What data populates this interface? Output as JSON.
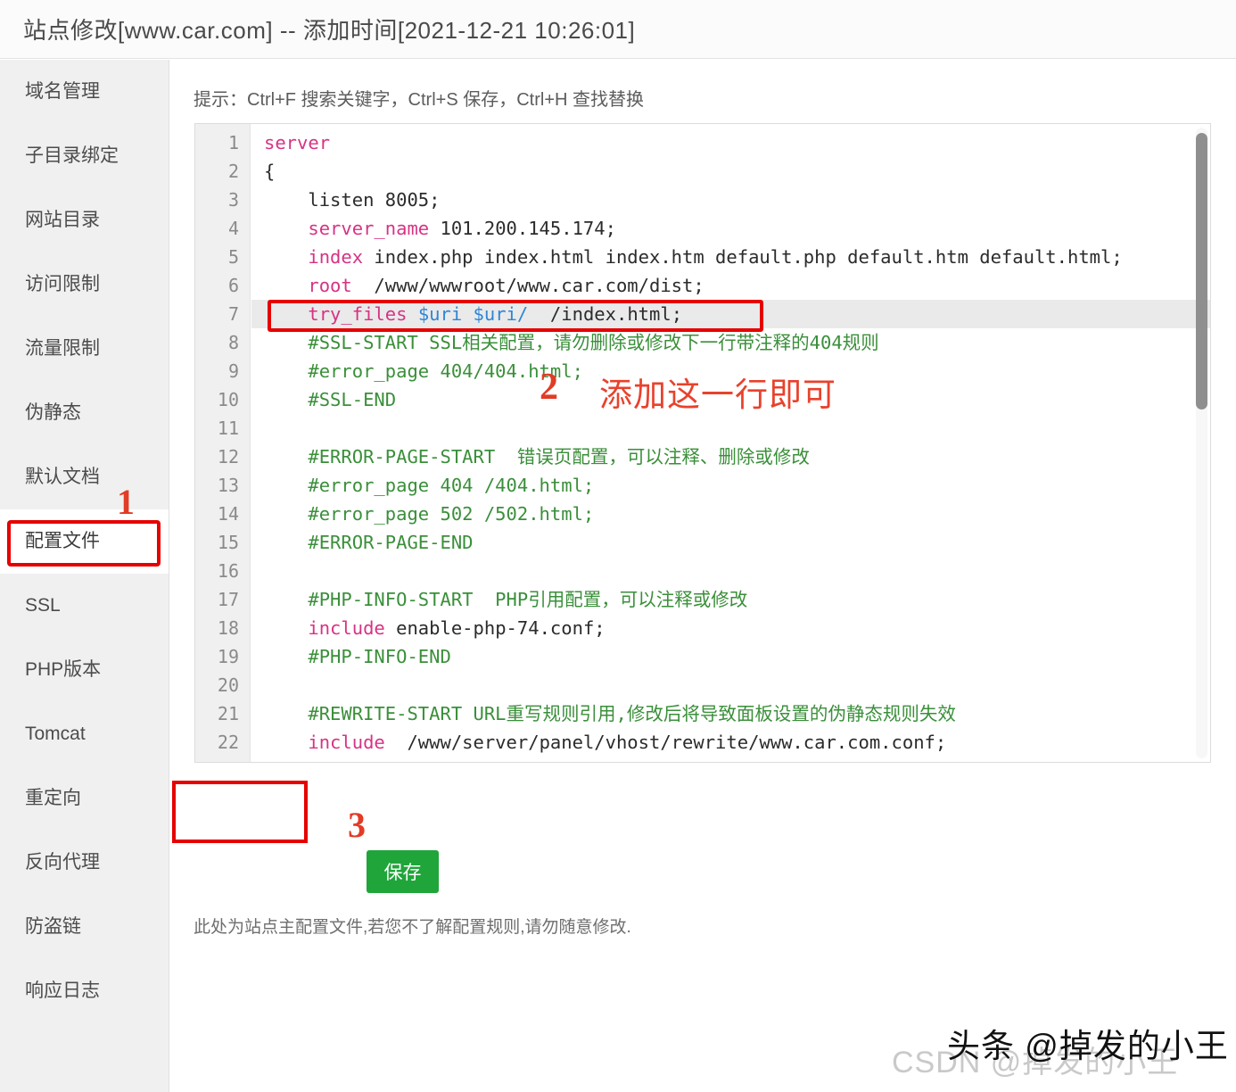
{
  "titlebar": {
    "title": "站点修改[www.car.com] -- 添加时间[2021-12-21 10:26:01]"
  },
  "sidebar": {
    "items": [
      {
        "label": "域名管理",
        "active": false
      },
      {
        "label": "子目录绑定",
        "active": false
      },
      {
        "label": "网站目录",
        "active": false
      },
      {
        "label": "访问限制",
        "active": false
      },
      {
        "label": "流量限制",
        "active": false
      },
      {
        "label": "伪静态",
        "active": false
      },
      {
        "label": "默认文档",
        "active": false
      },
      {
        "label": "配置文件",
        "active": true
      },
      {
        "label": "SSL",
        "active": false
      },
      {
        "label": "PHP版本",
        "active": false
      },
      {
        "label": "Tomcat",
        "active": false
      },
      {
        "label": "重定向",
        "active": false
      },
      {
        "label": "反向代理",
        "active": false
      },
      {
        "label": "防盗链",
        "active": false
      },
      {
        "label": "响应日志",
        "active": false
      }
    ]
  },
  "main": {
    "hint": "提示：Ctrl+F 搜索关键字，Ctrl+S 保存，Ctrl+H 查找替换",
    "save_label": "保存",
    "footnote": "此处为站点主配置文件,若您不了解配置规则,请勿随意修改."
  },
  "editor": {
    "scroll_thumb_position": "top",
    "highlighted_line": 7,
    "lines": [
      {
        "n": "1",
        "tokens": [
          {
            "t": "server",
            "c": "kw"
          }
        ]
      },
      {
        "n": "2",
        "tokens": [
          {
            "t": "{",
            "c": "plain"
          }
        ]
      },
      {
        "n": "3",
        "tokens": [
          {
            "t": "    listen 8005;",
            "c": "plain"
          }
        ]
      },
      {
        "n": "4",
        "tokens": [
          {
            "t": "    ",
            "c": "plain"
          },
          {
            "t": "server_name",
            "c": "kw"
          },
          {
            "t": " 101.200.145.174;",
            "c": "plain"
          }
        ]
      },
      {
        "n": "5",
        "tokens": [
          {
            "t": "    ",
            "c": "plain"
          },
          {
            "t": "index",
            "c": "kw"
          },
          {
            "t": " index.php index.html index.htm default.php default.htm default.html;",
            "c": "plain"
          }
        ]
      },
      {
        "n": "6",
        "tokens": [
          {
            "t": "    ",
            "c": "plain"
          },
          {
            "t": "root",
            "c": "kw"
          },
          {
            "t": "  /www/wwwroot/www.car.com/dist;",
            "c": "plain"
          }
        ]
      },
      {
        "n": "7",
        "tokens": [
          {
            "t": "    ",
            "c": "plain"
          },
          {
            "t": "try_files",
            "c": "kw"
          },
          {
            "t": " ",
            "c": "plain"
          },
          {
            "t": "$uri",
            "c": "var"
          },
          {
            "t": " ",
            "c": "plain"
          },
          {
            "t": "$uri/",
            "c": "var"
          },
          {
            "t": "  /index.html;",
            "c": "plain"
          }
        ]
      },
      {
        "n": "8",
        "tokens": [
          {
            "t": "    #SSL-START SSL相关配置，请勿删除或修改下一行带注释的404规则",
            "c": "cmt"
          }
        ]
      },
      {
        "n": "9",
        "tokens": [
          {
            "t": "    #error_page 404/404.html;",
            "c": "cmt"
          }
        ]
      },
      {
        "n": "10",
        "tokens": [
          {
            "t": "    #SSL-END",
            "c": "cmt"
          }
        ]
      },
      {
        "n": "11",
        "tokens": [
          {
            "t": "",
            "c": "plain"
          }
        ]
      },
      {
        "n": "12",
        "tokens": [
          {
            "t": "    #ERROR-PAGE-START  错误页配置，可以注释、删除或修改",
            "c": "cmt"
          }
        ]
      },
      {
        "n": "13",
        "tokens": [
          {
            "t": "    #error_page 404 /404.html;",
            "c": "cmt"
          }
        ]
      },
      {
        "n": "14",
        "tokens": [
          {
            "t": "    #error_page 502 /502.html;",
            "c": "cmt"
          }
        ]
      },
      {
        "n": "15",
        "tokens": [
          {
            "t": "    #ERROR-PAGE-END",
            "c": "cmt"
          }
        ]
      },
      {
        "n": "16",
        "tokens": [
          {
            "t": "",
            "c": "plain"
          }
        ]
      },
      {
        "n": "17",
        "tokens": [
          {
            "t": "    #PHP-INFO-START  PHP引用配置，可以注释或修改",
            "c": "cmt"
          }
        ]
      },
      {
        "n": "18",
        "tokens": [
          {
            "t": "    ",
            "c": "plain"
          },
          {
            "t": "include",
            "c": "kw"
          },
          {
            "t": " enable-php-74.conf;",
            "c": "plain"
          }
        ]
      },
      {
        "n": "19",
        "tokens": [
          {
            "t": "    #PHP-INFO-END",
            "c": "cmt"
          }
        ]
      },
      {
        "n": "20",
        "tokens": [
          {
            "t": "",
            "c": "plain"
          }
        ]
      },
      {
        "n": "21",
        "tokens": [
          {
            "t": "    #REWRITE-START URL重写规则引用,修改后将导致面板设置的伪静态规则失效",
            "c": "cmt"
          }
        ]
      },
      {
        "n": "22",
        "tokens": [
          {
            "t": "    ",
            "c": "plain"
          },
          {
            "t": "include",
            "c": "kw"
          },
          {
            "t": "  /www/server/panel/vhost/rewrite/www.car.com.conf;",
            "c": "plain"
          }
        ]
      }
    ]
  },
  "annotations": {
    "step1": "1",
    "step2": "2",
    "step2_text": "添加这一行即可",
    "step3": "3",
    "color": "#e60000"
  },
  "watermarks": {
    "csdn": "CSDN @掉发的小王",
    "toutiao": "头条 @掉发的小王"
  }
}
